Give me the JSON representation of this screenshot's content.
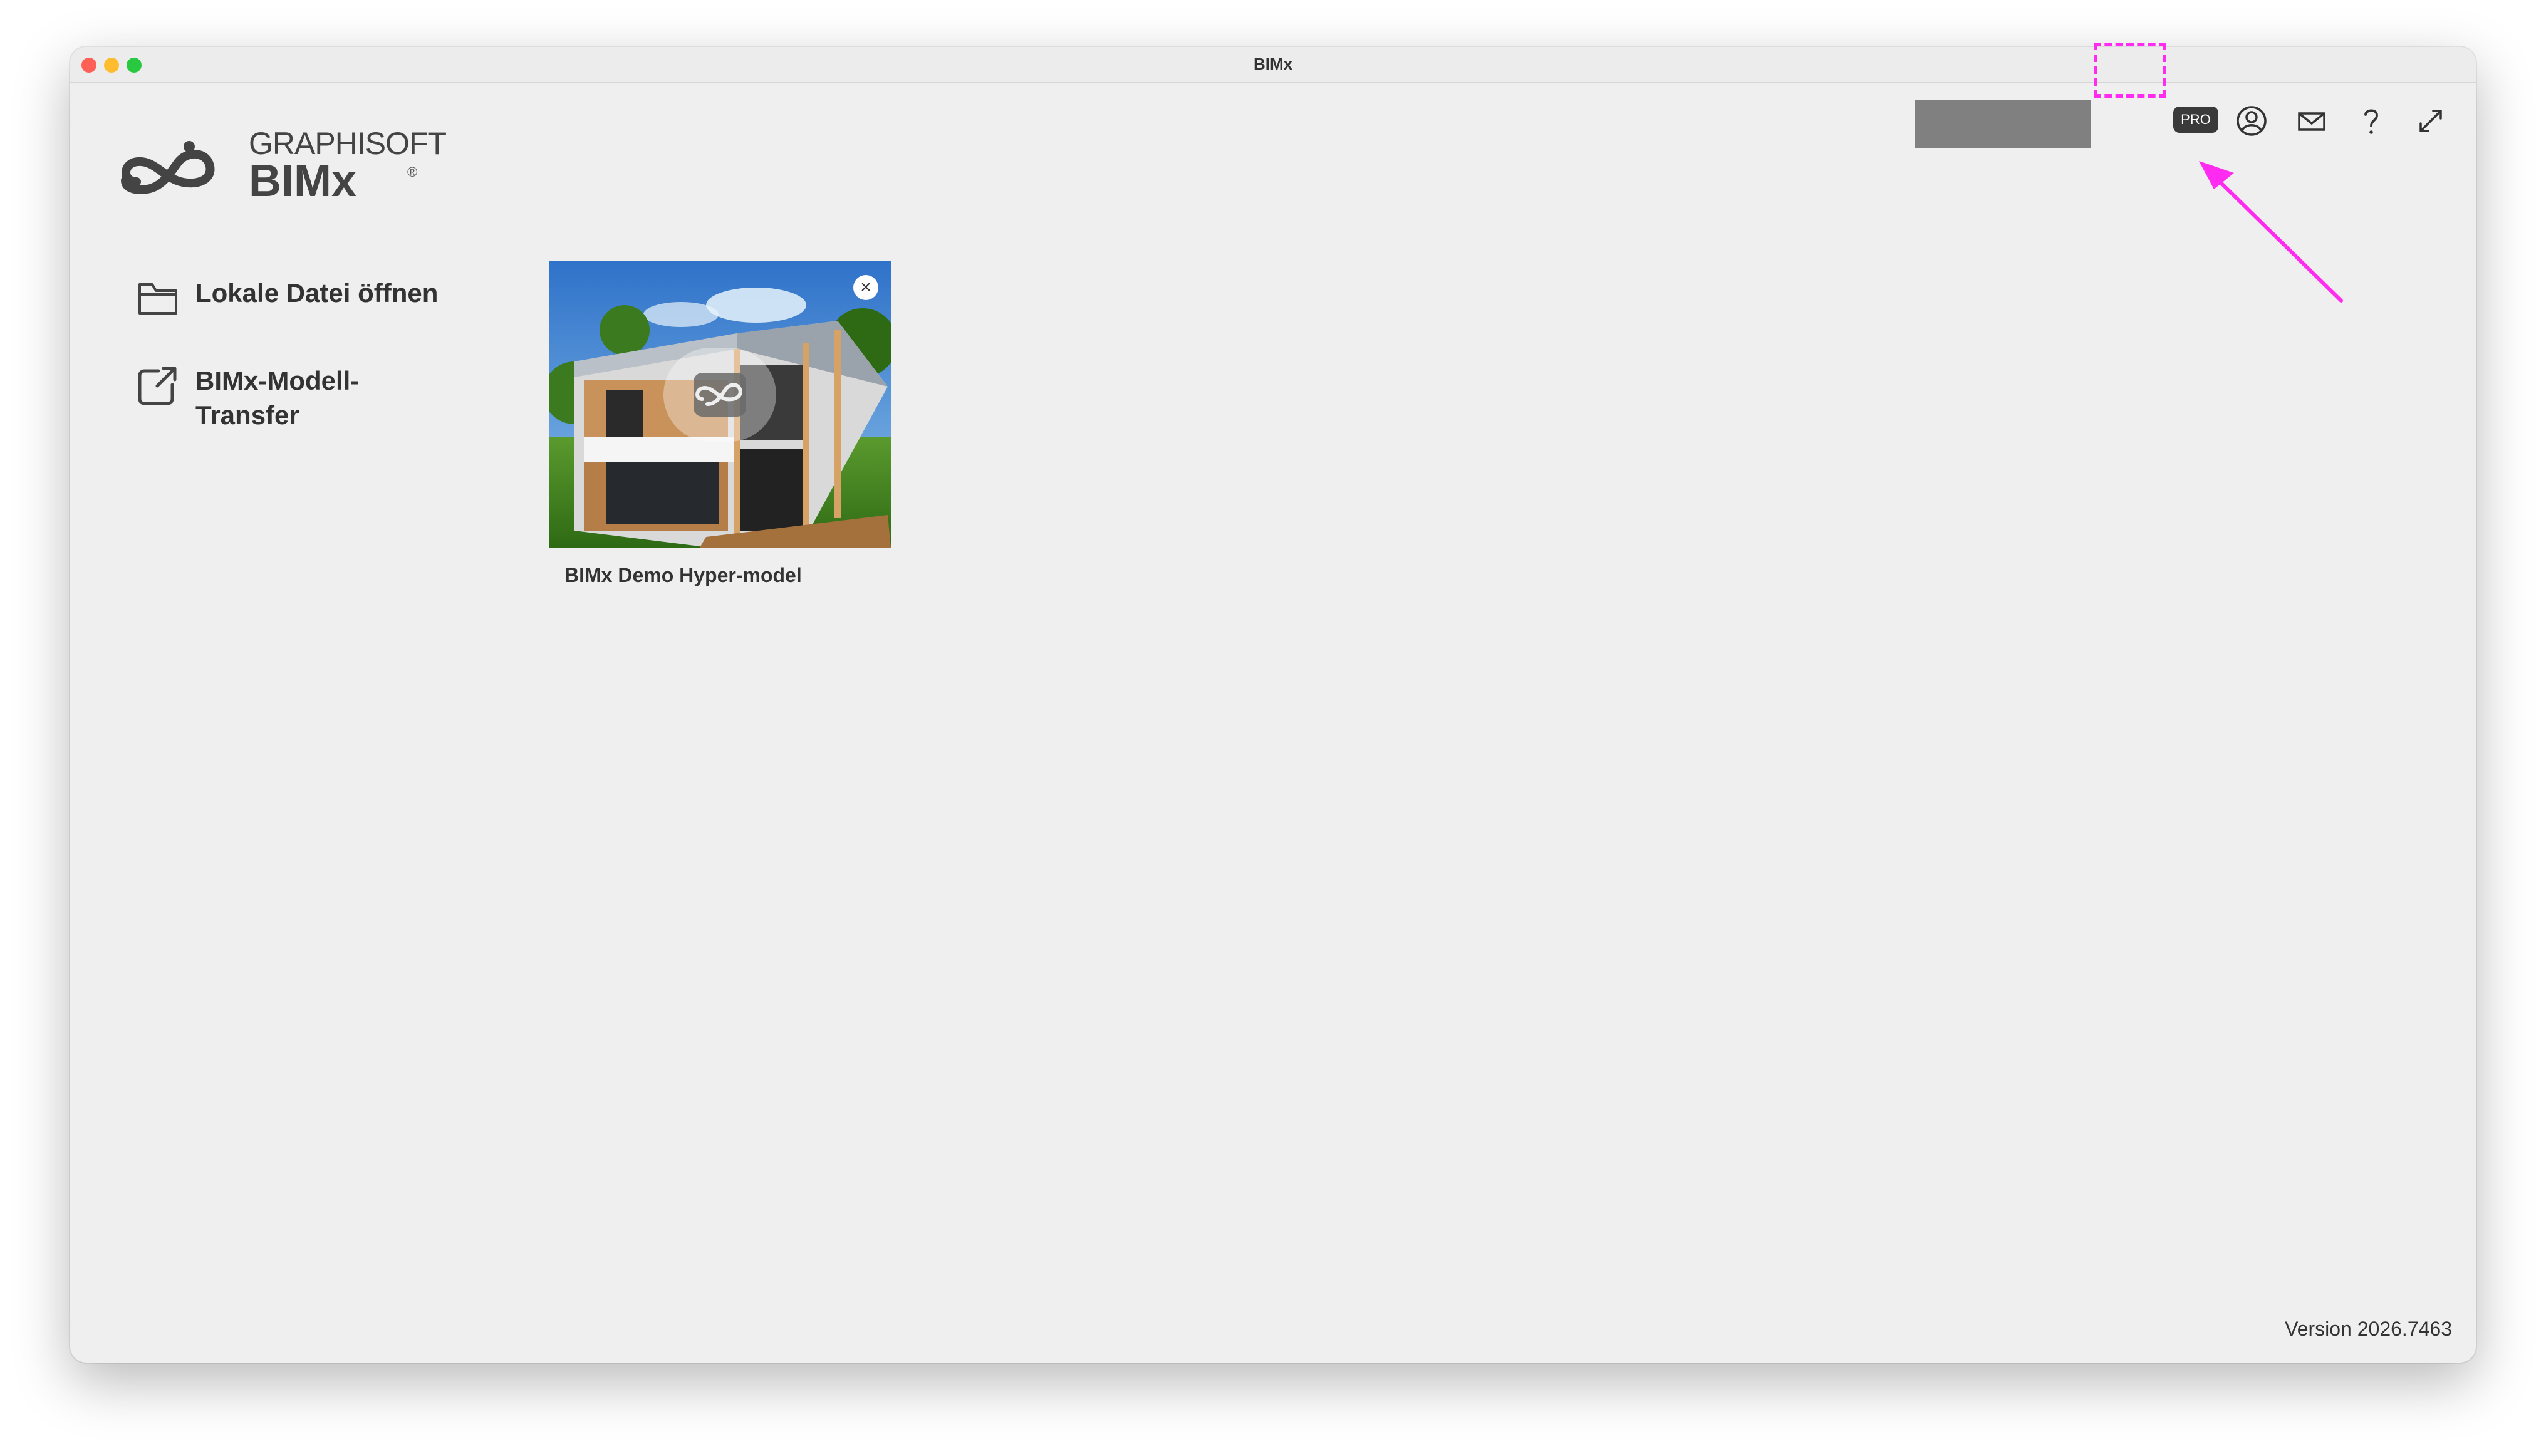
{
  "window": {
    "title": "BIMx"
  },
  "logo": {
    "brand": "GRAPHISOFT",
    "product": "BIMx",
    "registered": "®"
  },
  "actions": [
    {
      "label": "Lokale Datei öffnen",
      "icon": "folder-icon"
    },
    {
      "label": "BIMx-Modell-Transfer",
      "icon": "external-link-icon"
    }
  ],
  "models": [
    {
      "name": "BIMx Demo Hyper-model"
    }
  ],
  "toolbar": {
    "pro_label": "PRO",
    "icons": [
      "user-icon",
      "mail-icon",
      "help-icon",
      "fullscreen-icon"
    ]
  },
  "footer": {
    "version": "Version 2026.7463"
  },
  "colors": {
    "annotation": "#ff2bf0",
    "window_bg": "#efefef",
    "pro_badge_bg": "#3a3a3a"
  }
}
